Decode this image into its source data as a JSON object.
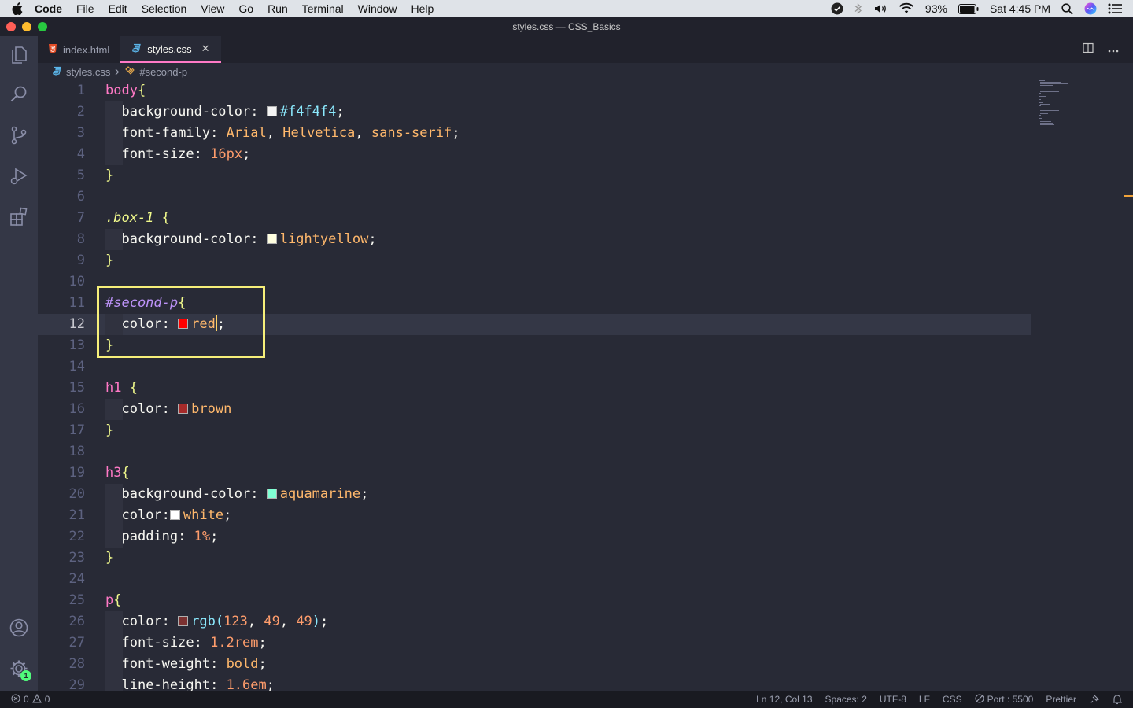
{
  "menubar": {
    "app": "Code",
    "items": [
      "File",
      "Edit",
      "Selection",
      "View",
      "Go",
      "Run",
      "Terminal",
      "Window",
      "Help"
    ],
    "battery": "93%",
    "clock": "Sat 4:45 PM"
  },
  "window": {
    "title": "styles.css — CSS_Basics"
  },
  "tabs": [
    {
      "label": "index.html",
      "icon": "html5-icon",
      "active": false
    },
    {
      "label": "styles.css",
      "icon": "css3-icon",
      "active": true,
      "close": "✕"
    }
  ],
  "breadcrumb": {
    "file": "styles.css",
    "symbol": "#second-p"
  },
  "editor": {
    "current_line": 12,
    "lines": [
      {
        "n": "1"
      },
      {
        "n": "2"
      },
      {
        "n": "3"
      },
      {
        "n": "4"
      },
      {
        "n": "5"
      },
      {
        "n": "6"
      },
      {
        "n": "7"
      },
      {
        "n": "8"
      },
      {
        "n": "9"
      },
      {
        "n": "10"
      },
      {
        "n": "11"
      },
      {
        "n": "12"
      },
      {
        "n": "13"
      },
      {
        "n": "14"
      },
      {
        "n": "15"
      },
      {
        "n": "16"
      },
      {
        "n": "17"
      },
      {
        "n": "18"
      },
      {
        "n": "19"
      },
      {
        "n": "20"
      },
      {
        "n": "21"
      },
      {
        "n": "22"
      },
      {
        "n": "23"
      },
      {
        "n": "24"
      },
      {
        "n": "25"
      },
      {
        "n": "26"
      },
      {
        "n": "27"
      },
      {
        "n": "28"
      },
      {
        "n": "29"
      }
    ],
    "tokens": {
      "l1": {
        "sel": "body",
        "brace": "{"
      },
      "l2": {
        "prop": "background-color:",
        "swatch": "#f4f4f4",
        "val": "#f4f4f4",
        "end": ";"
      },
      "l3": {
        "prop": "font-family:",
        "v1": "Arial",
        "c1": ",",
        "v2": "Helvetica",
        "c2": ",",
        "v3": "sans-serif",
        "end": ";"
      },
      "l4": {
        "prop": "font-size:",
        "num": "16",
        "unit": "px",
        "end": ";"
      },
      "l5": {
        "brace": "}"
      },
      "l7": {
        "sel": ".box-1",
        "brace": "{"
      },
      "l8": {
        "prop": "background-color:",
        "swatch": "#ffffe0",
        "val": "lightyellow",
        "end": ";"
      },
      "l9": {
        "brace": "}"
      },
      "l11": {
        "sel": "#second-p",
        "brace": "{"
      },
      "l12": {
        "prop": "color:",
        "swatch": "#ff0000",
        "val": "red",
        "end": ";"
      },
      "l13": {
        "brace": "}"
      },
      "l15": {
        "sel": "h1",
        "brace": "{"
      },
      "l16": {
        "prop": "color:",
        "swatch": "#a52a2a",
        "val": "brown"
      },
      "l17": {
        "brace": "}"
      },
      "l19": {
        "sel": "h3",
        "brace": "{"
      },
      "l20": {
        "prop": "background-color:",
        "swatch": "#7fffd4",
        "val": "aquamarine",
        "end": ";"
      },
      "l21": {
        "prop": "color:",
        "swatch": "#ffffff",
        "val": "white",
        "end": ";"
      },
      "l22": {
        "prop": "padding:",
        "num": "1",
        "unit": "%",
        "end": ";"
      },
      "l23": {
        "brace": "}"
      },
      "l25": {
        "sel": "p",
        "brace": "{"
      },
      "l26": {
        "prop": "color:",
        "swatch": "#7b3131",
        "fn": "rgb(",
        "n1": "123",
        "c1": ",",
        "n2": "49",
        "c2": ",",
        "n3": "49",
        "close": ")",
        "end": ";"
      },
      "l27": {
        "prop": "font-size:",
        "num": "1.2",
        "unit": "rem",
        "end": ";"
      },
      "l28": {
        "prop": "font-weight:",
        "val": "bold",
        "end": ";"
      },
      "l29": {
        "prop": "line-height:",
        "num": "1.6",
        "unit": "em",
        "end": ";"
      }
    }
  },
  "statusbar": {
    "errors": "0",
    "warnings": "0",
    "position": "Ln 12, Col 13",
    "spaces": "Spaces: 2",
    "encoding": "UTF-8",
    "eol": "LF",
    "language": "CSS",
    "port": "Port : 5500",
    "formatter": "Prettier"
  },
  "activitybar": {
    "settings_badge": "1"
  },
  "colors": {
    "accent": "#ff79c6",
    "highlight_box": "#f6ef7a",
    "background": "#282a36"
  }
}
